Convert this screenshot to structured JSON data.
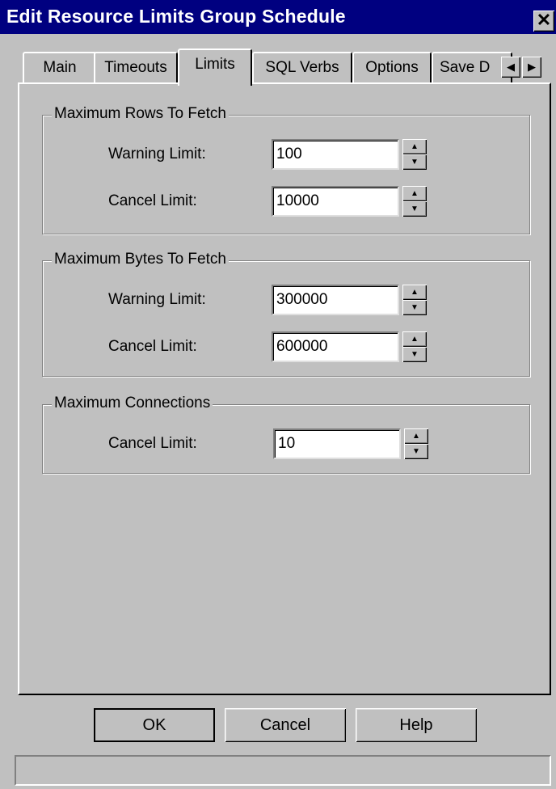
{
  "window": {
    "title": "Edit Resource Limits Group Schedule",
    "close_glyph": "✕"
  },
  "tabs": [
    {
      "label": "Main"
    },
    {
      "label": "Timeouts"
    },
    {
      "label": "Limits",
      "active": true
    },
    {
      "label": "SQL Verbs"
    },
    {
      "label": "Options"
    },
    {
      "label": "Save D"
    }
  ],
  "tab_scroll": {
    "left": "◀",
    "right": "▶"
  },
  "groups": {
    "rows": {
      "title": "Maximum Rows To Fetch",
      "warning": {
        "label": "Warning Limit:",
        "value": "100"
      },
      "cancel": {
        "label": "Cancel Limit:",
        "value": "10000"
      }
    },
    "bytes": {
      "title": "Maximum Bytes To Fetch",
      "warning": {
        "label": "Warning Limit:",
        "value": "300000"
      },
      "cancel": {
        "label": "Cancel Limit:",
        "value": "600000"
      }
    },
    "connections": {
      "title": "Maximum Connections",
      "cancel": {
        "label": "Cancel Limit:",
        "value": "10"
      }
    }
  },
  "spinner": {
    "up": "▲",
    "down": "▼"
  },
  "buttons": {
    "ok": "OK",
    "cancel": "Cancel",
    "help": "Help"
  },
  "status": {
    "text": ""
  }
}
